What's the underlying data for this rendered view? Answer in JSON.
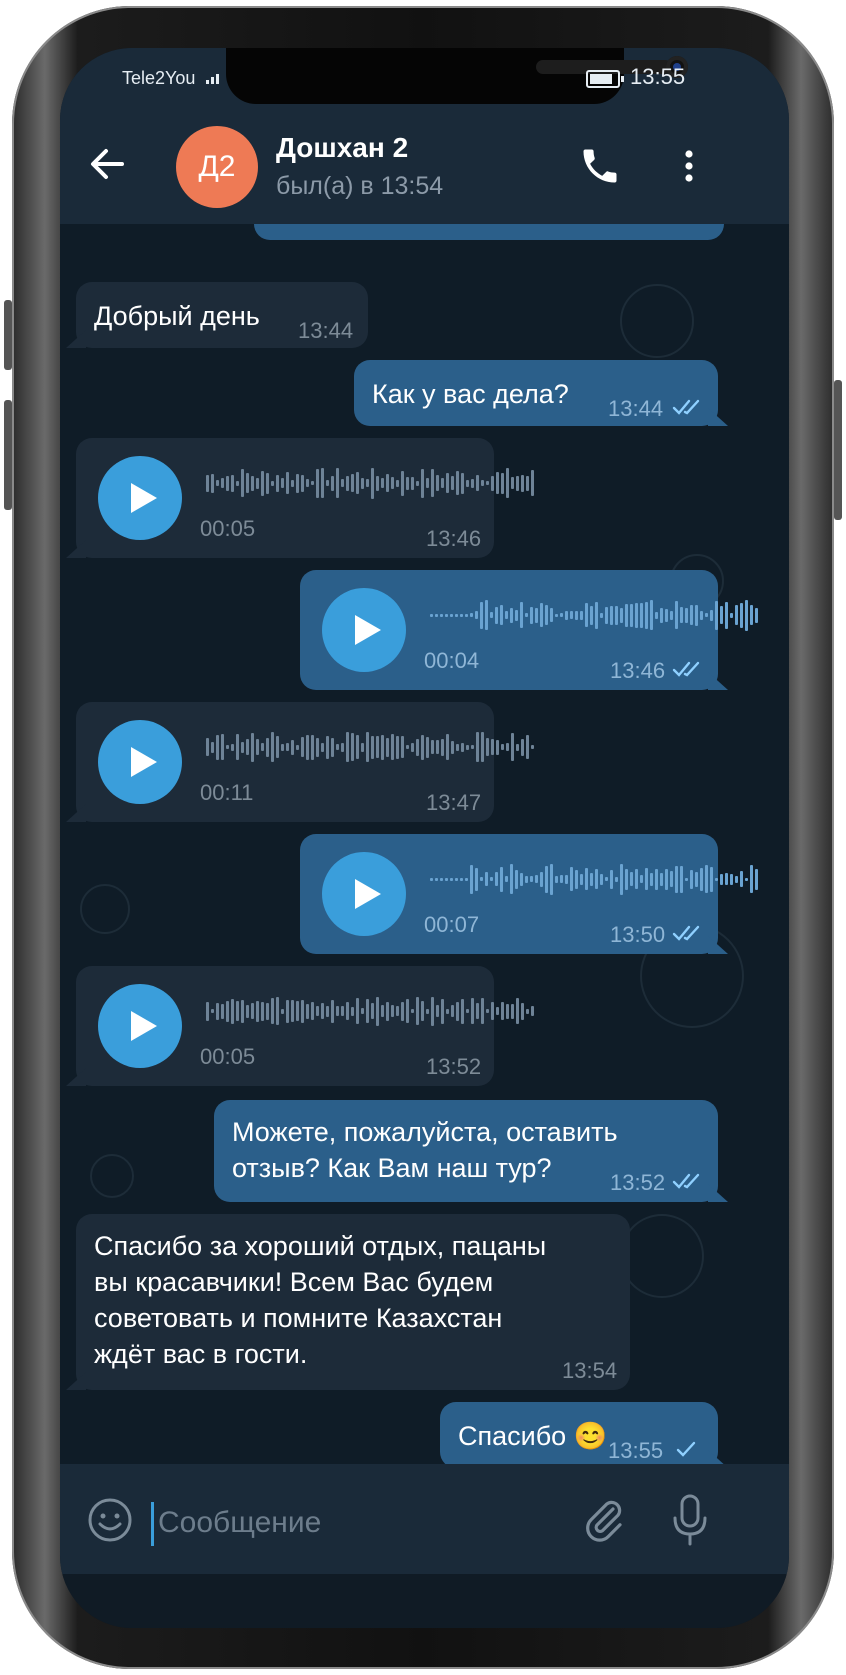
{
  "status_bar": {
    "carrier": "Tele2You",
    "time": "13:55"
  },
  "header": {
    "avatar_initials": "Д2",
    "avatar_color": "#ee7a55",
    "contact_name": "Дошхан 2",
    "last_seen": "был(а) в 13:54"
  },
  "messages": [
    {
      "dir": "in",
      "type": "text",
      "text": "Добрый день",
      "time": "13:44"
    },
    {
      "dir": "out",
      "type": "text",
      "text": "Как у вас дела?",
      "time": "13:44",
      "read": true
    },
    {
      "dir": "in",
      "type": "voice",
      "duration": "00:05",
      "time": "13:46"
    },
    {
      "dir": "out",
      "type": "voice",
      "duration": "00:04",
      "time": "13:46",
      "read": true
    },
    {
      "dir": "in",
      "type": "voice",
      "duration": "00:11",
      "time": "13:47"
    },
    {
      "dir": "out",
      "type": "voice",
      "duration": "00:07",
      "time": "13:50",
      "read": true
    },
    {
      "dir": "in",
      "type": "voice",
      "duration": "00:05",
      "time": "13:52"
    },
    {
      "dir": "out",
      "type": "text",
      "lines": [
        "Можете, пожалуйста, оставить",
        "отзыв? Как Вам наш тур?"
      ],
      "time": "13:52",
      "read": true
    },
    {
      "dir": "in",
      "type": "text",
      "lines": [
        "Спасибо за хороший отдых, пацаны",
        "вы красавчики! Всем Вас будем",
        "советовать и помните Казахстан",
        "ждёт вас в гости."
      ],
      "time": "13:54"
    },
    {
      "dir": "out",
      "type": "text",
      "text": "Спасибо 😊",
      "time": "13:55",
      "read": false
    }
  ],
  "input": {
    "placeholder": "Сообщение"
  },
  "colors": {
    "accent": "#3a9edb",
    "bubble_in": "#1d2b39",
    "bubble_out": "#2b5f8a",
    "header": "#1a2a39"
  }
}
